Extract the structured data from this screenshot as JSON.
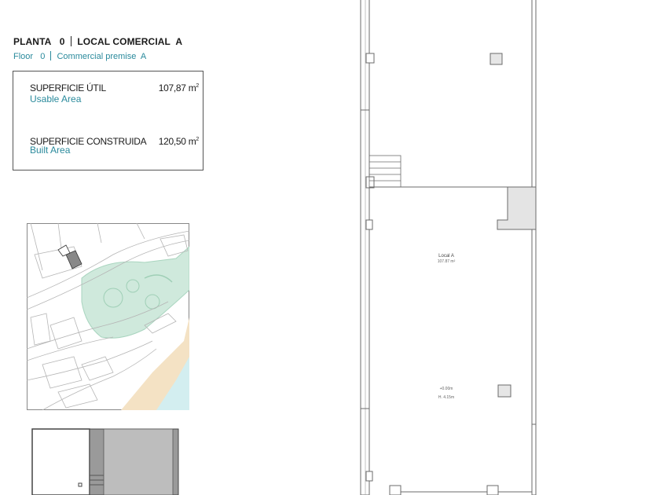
{
  "header": {
    "line1": {
      "planta": "PLANTA",
      "planta_num": "0",
      "local": "LOCAL COMERCIAL",
      "local_letter": "A"
    },
    "line2": {
      "floor": "Floor",
      "floor_num": "0",
      "premise": "Commercial premise",
      "premise_letter": "A"
    }
  },
  "areas": {
    "usable": {
      "label": "SUPERFICIE ÚTIL",
      "label_en": "Usable Area",
      "value": "107,87 m",
      "sup": "2"
    },
    "built": {
      "label": "SUPERFICIE CONSTRUIDA",
      "label_en": "Built Area",
      "value": "120,50 m",
      "sup": "2"
    }
  },
  "plan": {
    "room_name": "Local A",
    "room_area": "107.87 m²",
    "level": "+0.00m",
    "height": "H. 4.15m"
  },
  "colors": {
    "accent": "#2a8a9c",
    "green_area": "#cfe9dc",
    "beach": "#f4e2c4",
    "sea": "#d3eef0",
    "highlight": "#888888"
  }
}
